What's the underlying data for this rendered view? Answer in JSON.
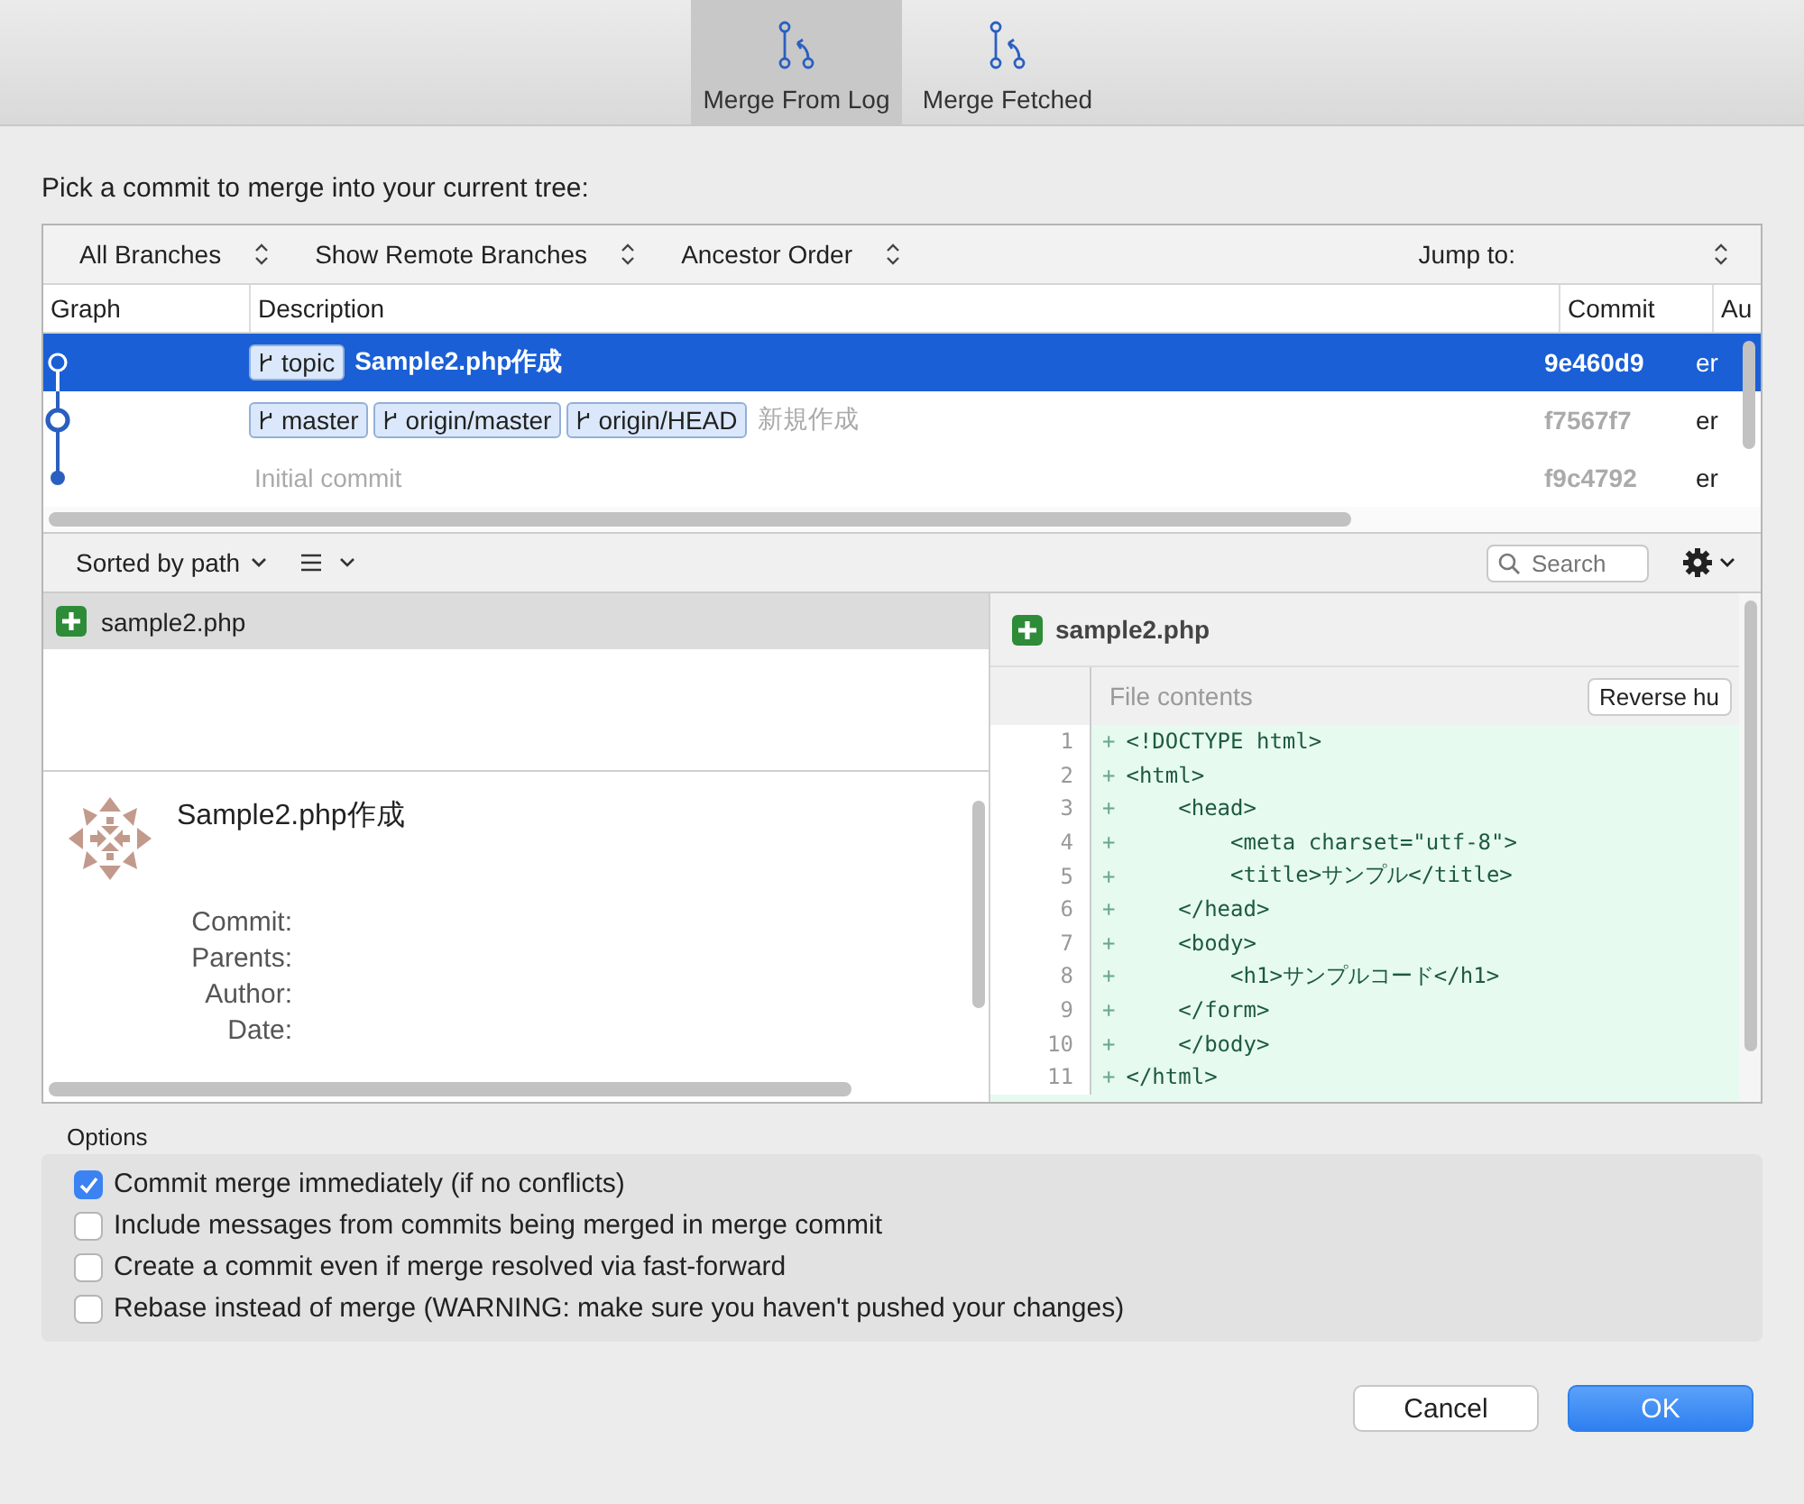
{
  "toolbar": {
    "tabs": [
      {
        "label": "Merge From Log",
        "selected": true
      },
      {
        "label": "Merge Fetched",
        "selected": false
      }
    ]
  },
  "prompt": "Pick a commit to merge into your current tree:",
  "filters": {
    "branches": "All Branches",
    "remote": "Show Remote Branches",
    "order": "Ancestor Order",
    "jump_label": "Jump to:"
  },
  "table": {
    "columns": [
      "Graph",
      "Description",
      "Commit",
      "Au"
    ],
    "rows": [
      {
        "selected": true,
        "kind": "hollow",
        "muted": false,
        "refs": [
          "topic"
        ],
        "description": "Sample2.php作成",
        "commit": "9e460d9",
        "author": "er"
      },
      {
        "selected": false,
        "kind": "ring",
        "muted": true,
        "refs": [
          "master",
          "origin/master",
          "origin/HEAD"
        ],
        "description": "新規作成",
        "commit": "f7567f7",
        "author": "er"
      },
      {
        "selected": false,
        "kind": "dot",
        "muted": true,
        "refs": [],
        "description": "Initial commit",
        "commit": "f9c4792",
        "author": "er"
      }
    ]
  },
  "file_toolbar": {
    "sort": "Sorted by path",
    "search_placeholder": "Search"
  },
  "files": [
    {
      "name": "sample2.php",
      "selected": true
    }
  ],
  "details": {
    "title": "Sample2.php作成",
    "labels": [
      "Commit:",
      "Parents:",
      "Author:",
      "Date:"
    ]
  },
  "diff": {
    "file": "sample2.php",
    "section": "File contents",
    "reverse_button": "Reverse hu",
    "lines": [
      {
        "number": "1",
        "sign": "+",
        "text": "<!DOCTYPE html>"
      },
      {
        "number": "2",
        "sign": "+",
        "text": "<html>"
      },
      {
        "number": "3",
        "sign": "+",
        "text": "    <head>"
      },
      {
        "number": "4",
        "sign": "+",
        "text": "        <meta charset=\"utf-8\">"
      },
      {
        "number": "5",
        "sign": "+",
        "text": "        <title>サンプル</title>"
      },
      {
        "number": "6",
        "sign": "+",
        "text": "    </head>"
      },
      {
        "number": "7",
        "sign": "+",
        "text": "    <body>"
      },
      {
        "number": "8",
        "sign": "+",
        "text": "        <h1>サンプルコード</h1>"
      },
      {
        "number": "9",
        "sign": "+",
        "text": "    </form>"
      },
      {
        "number": "10",
        "sign": "+",
        "text": "    </body>"
      },
      {
        "number": "11",
        "sign": "+",
        "text": "</html>"
      }
    ]
  },
  "options": {
    "title": "Options",
    "items": [
      {
        "label": "Commit merge immediately (if no conflicts)",
        "checked": true
      },
      {
        "label": "Include messages from commits being merged in merge commit",
        "checked": false
      },
      {
        "label": "Create a commit even if merge resolved via fast-forward",
        "checked": false
      },
      {
        "label": "Rebase instead of merge (WARNING: make sure you haven't pushed your changes)",
        "checked": false
      }
    ]
  },
  "buttons": [
    {
      "label": "Cancel",
      "kind": "secondary"
    },
    {
      "label": "OK",
      "kind": "primary"
    }
  ]
}
